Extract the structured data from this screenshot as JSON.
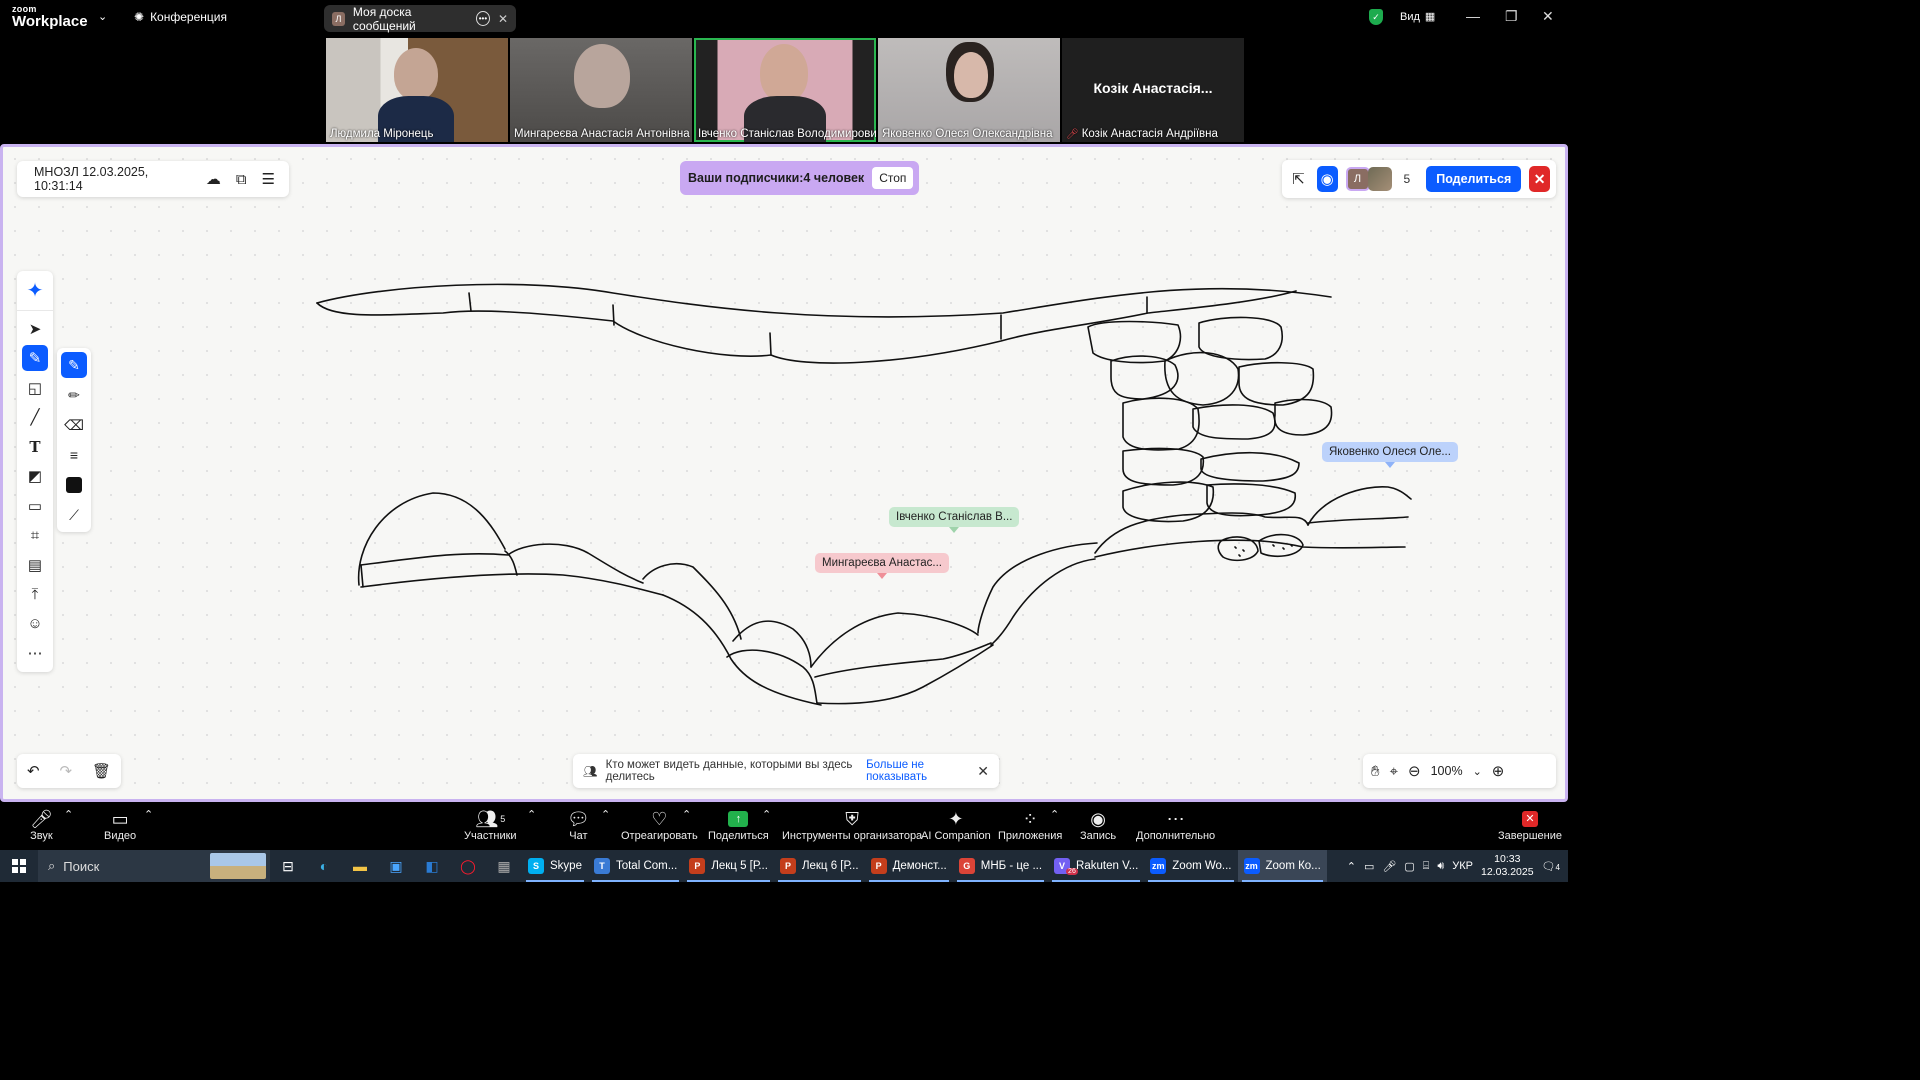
{
  "titlebar": {
    "logo_small": "zoom",
    "logo_big": "Workplace",
    "conference_label": "Конференция",
    "board_tab_avatar": "Л",
    "board_tab_label": "Моя доска сообщений",
    "view_label": "Вид",
    "security_color": "#1dab4e"
  },
  "videos": [
    {
      "name": "Людмила Міронець"
    },
    {
      "name": "Мингареєва Анастасія Антонівна"
    },
    {
      "name": "Івченко Станіслав Володимирович."
    },
    {
      "name": "Яковенко Олеся Олександрівна"
    },
    {
      "display": "Козік Анастасія...",
      "name": "Козік Анастасія Андріївна",
      "muted": true
    }
  ],
  "board": {
    "doc_title": "МНОЗЛ 12.03.2025, 10:31:14",
    "followers_text": "Ваши подписчики:4 человек",
    "stop_label": "Стоп",
    "avatar_letter": "Л",
    "participants_count": "5",
    "share_label": "Поделиться",
    "accent_color": "#0b5cff",
    "frame_color": "#c9b3f0",
    "cursors": [
      {
        "name": "Івченко Станіслав В...",
        "color": "#c7e8cf"
      },
      {
        "name": "Мингареєва Анастас...",
        "color": "#f6c9cd"
      },
      {
        "name": "Яковенко Олеся Оле...",
        "color": "#bcd2fb"
      }
    ],
    "notice_text": "Кто может видеть данные, которыми вы здесь делитесь",
    "notice_link": "Больше не показывать",
    "zoom_level": "100%",
    "toolbar_icons": [
      "ai-companion-icon",
      "select-icon",
      "pen-icon",
      "shapes-icon",
      "line-icon",
      "text-icon",
      "sticky-note-icon",
      "comment-icon",
      "frame-icon",
      "template-icon",
      "upload-icon",
      "emoji-icon",
      "more-icon"
    ],
    "pen_options": [
      "pen-icon",
      "pencil-icon",
      "eraser-icon",
      "stroke-width-icon",
      "color-swatch",
      "magic-pen-icon"
    ]
  },
  "controls": {
    "audio": "Звук",
    "video": "Видео",
    "participants": "Участники",
    "participants_count": "5",
    "chat": "Чат",
    "react": "Отреагировать",
    "share": "Поделиться",
    "host_tools": "Инструменты организатора",
    "ai": "AI Companion",
    "apps": "Приложения",
    "record": "Запись",
    "more": "Дополнительно",
    "end": "Завершение"
  },
  "taskbar": {
    "search": "Поиск",
    "apps": [
      {
        "label": "Skype",
        "color": "#00aff0",
        "glyph": "S"
      },
      {
        "label": "Total Com...",
        "color": "#3a7bd5",
        "glyph": "T"
      },
      {
        "label": "Лекц 5 [Р...",
        "color": "#c43e1c",
        "glyph": "P"
      },
      {
        "label": "Лекц 6 [Р...",
        "color": "#c43e1c",
        "glyph": "P"
      },
      {
        "label": "Демонст...",
        "color": "#c43e1c",
        "glyph": "P"
      },
      {
        "label": "МНБ - це ...",
        "color": "#db4437",
        "glyph": "G"
      },
      {
        "label": "Rakuten V...",
        "color": "#7360f2",
        "glyph": "V",
        "badge": "26"
      },
      {
        "label": "Zoom Wo...",
        "color": "#0b5cff",
        "glyph": "zm"
      },
      {
        "label": "Zoom Ко...",
        "color": "#0b5cff",
        "glyph": "zm",
        "active": true
      }
    ],
    "lang": "УКР",
    "time": "10:33",
    "date": "12.03.2025",
    "notif_count": "4"
  }
}
